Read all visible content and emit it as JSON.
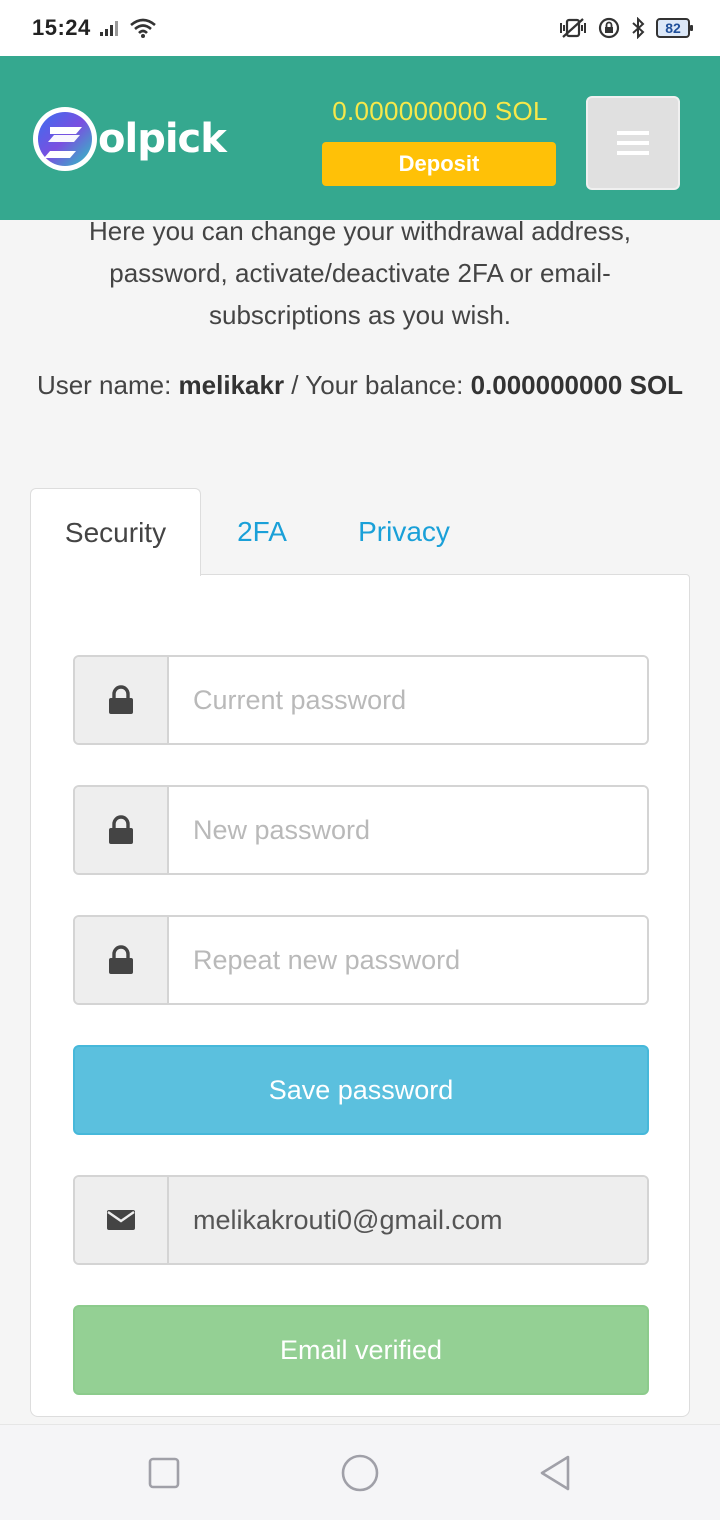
{
  "status_bar": {
    "time": "15:24",
    "battery": "82"
  },
  "header": {
    "logo_text": "olpick",
    "balance": "0.000000000 SOL",
    "deposit_label": "Deposit",
    "menu_icon": "hamburger-icon"
  },
  "intro": {
    "text": "Here you can change your withdrawal address, password, activate/deactivate 2FA or email-subscriptions as you wish."
  },
  "user_line": {
    "user_label": "User name: ",
    "username": "melikakr",
    "separator": " / Your balance: ",
    "balance": "0.000000000 SOL"
  },
  "tabs": [
    {
      "label": "Security",
      "active": true
    },
    {
      "label": "2FA",
      "active": false
    },
    {
      "label": "Privacy",
      "active": false
    }
  ],
  "security": {
    "current_password_placeholder": "Current password",
    "new_password_placeholder": "New password",
    "repeat_password_placeholder": "Repeat new password",
    "save_label": "Save password",
    "email_value": "melikakrouti0@gmail.com",
    "email_verified_label": "Email verified"
  },
  "colors": {
    "header_bg": "#35a88f",
    "balance_text": "#f7e84a",
    "deposit_bg": "#ffc107",
    "tab_link": "#1aa0d8",
    "save_button": "#5bc0de",
    "verified_button": "#94d094"
  }
}
